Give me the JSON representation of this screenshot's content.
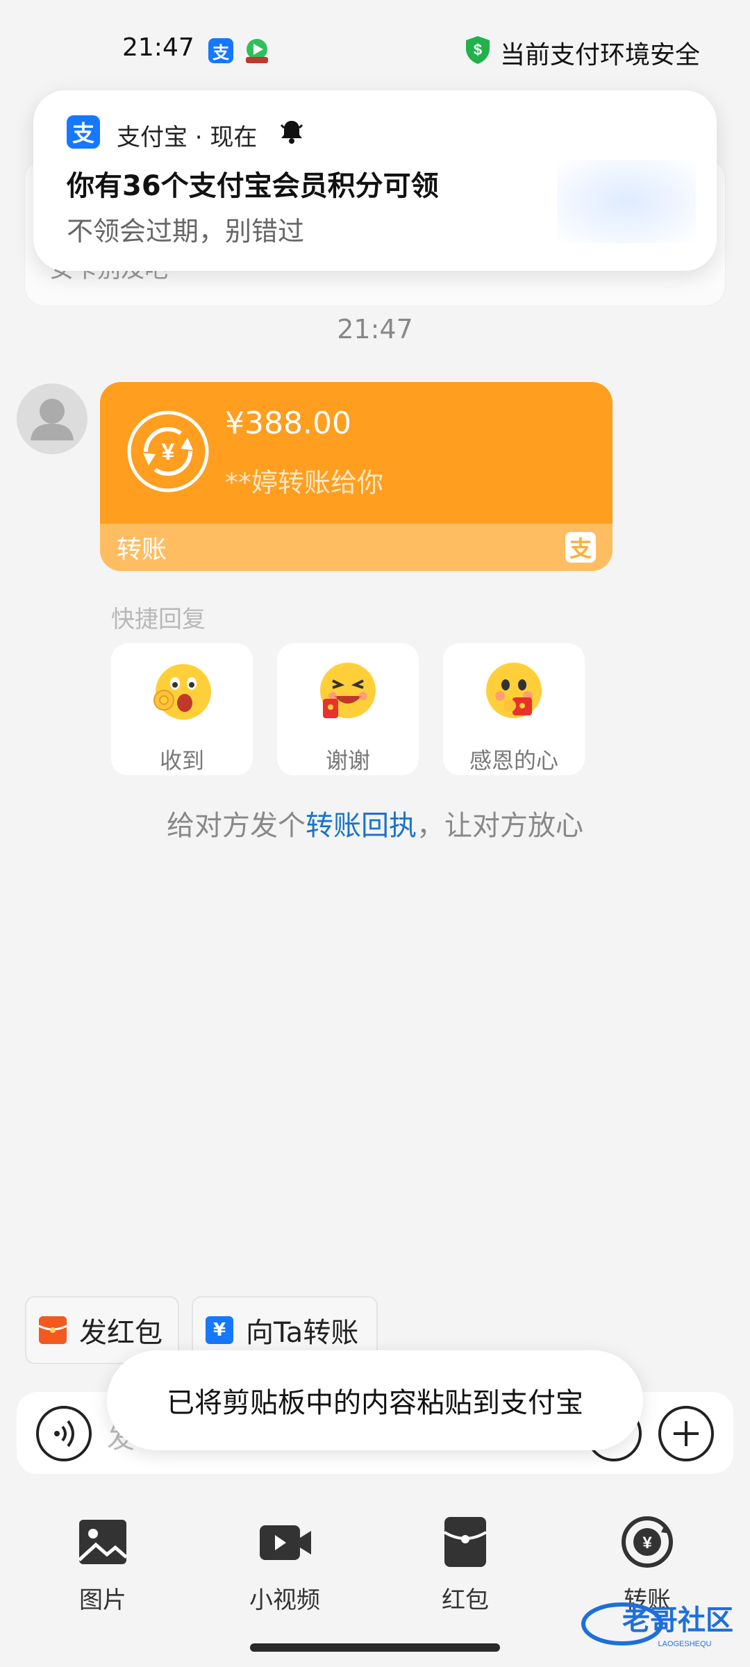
{
  "status_bar": {
    "time": "21:47",
    "app_icon_1": {
      "icon": "alipay-icon",
      "glyph": "支",
      "color": "#1677ff"
    },
    "app_icon_2": {
      "icon": "video-app-icon"
    },
    "shield_color": "#22b14c",
    "safety_text": "当前支付环境安全"
  },
  "notification": {
    "app_glyph": "支",
    "app_line": "支付宝 · 现在",
    "title": "你有36个支付宝会员积分可领",
    "body": "不领会过期，别错过"
  },
  "background_card_text": "女卡别及吧",
  "chat": {
    "time": "21:47",
    "transfer": {
      "amount": "¥388.00",
      "subtitle": "**婷转账给你",
      "label": "转账",
      "logo_glyph": "支",
      "color": "#ff9e1f"
    },
    "quick_reply": {
      "label": "快捷回复",
      "items": [
        {
          "label": "收到",
          "icon": "ok-hand-emoji-icon"
        },
        {
          "label": "谢谢",
          "icon": "grinning-red-packet-emoji-icon"
        },
        {
          "label": "感恩的心",
          "icon": "grateful-red-packet-emoji-icon"
        }
      ]
    },
    "receipt_tip": {
      "before": "给对方发个",
      "link": "转账回执",
      "after": "，让对方放心",
      "link_color": "#1a73c8"
    }
  },
  "shortcuts": {
    "red_packet": {
      "label": "发红包",
      "icon": "red-packet-icon",
      "color": "#f25a1f"
    },
    "transfer": {
      "label": "向Ta转账",
      "icon": "transfer-icon",
      "glyph": "¥",
      "color": "#1677ff"
    }
  },
  "input": {
    "placeholder": "发"
  },
  "toast": "已将剪贴板中的内容粘贴到支付宝",
  "toolbar": {
    "items": [
      {
        "label": "图片",
        "icon": "image-icon"
      },
      {
        "label": "小视频",
        "icon": "video-icon"
      },
      {
        "label": "红包",
        "icon": "red-packet-icon"
      },
      {
        "label": "转账",
        "icon": "transfer-icon"
      }
    ]
  },
  "watermark": {
    "text": "老哥社区",
    "subtext": "LAOGESHEQU"
  }
}
